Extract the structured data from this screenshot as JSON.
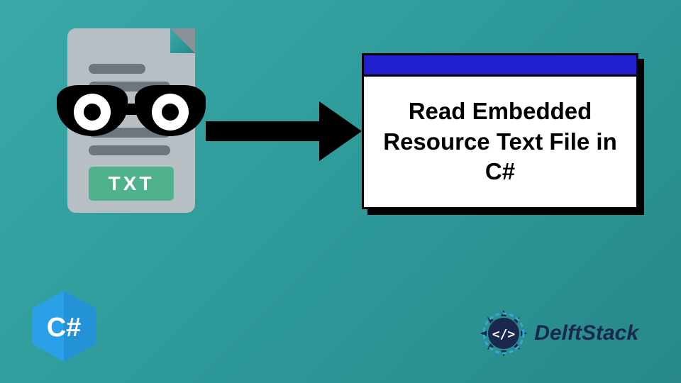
{
  "file_icon": {
    "txt_label": "TXT"
  },
  "window": {
    "title": "Read Embedded Resource Text File in C#"
  },
  "logos": {
    "csharp_label": "C#",
    "delft_label": "DelftStack",
    "delft_code": "</>"
  },
  "colors": {
    "background_start": "#3ba8a8",
    "background_end": "#288888",
    "txt_badge": "#4fb28c",
    "window_titlebar": "#2020d0",
    "csharp_hex": "#2aa0e8",
    "delft_navy": "#1a2850"
  }
}
